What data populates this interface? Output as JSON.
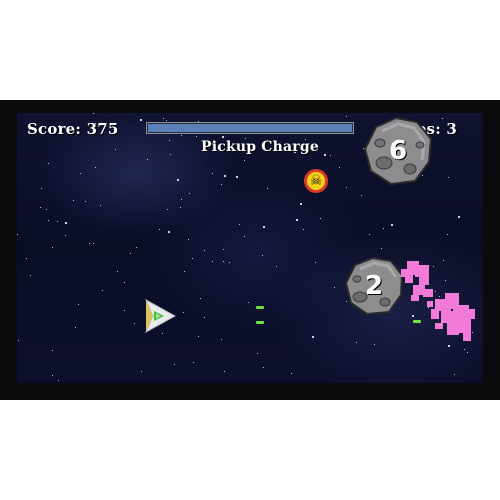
{
  "hud": {
    "score": "Score: 375",
    "lives": "Lives: 3",
    "charge_label": "Pickup Charge",
    "charge_level": 1.0
  },
  "pickup": {
    "icon": "skull-crossbones-icon",
    "glyph": "☠"
  },
  "asteroids": [
    {
      "number": "6"
    },
    {
      "number": "2"
    }
  ],
  "colors": {
    "charge_fill": "#5b80b8",
    "laser": "#6fe04a",
    "explosion": "#f27ad8",
    "pickup_fill": "#f3d21c",
    "pickup_ring": "#d93a2a"
  }
}
